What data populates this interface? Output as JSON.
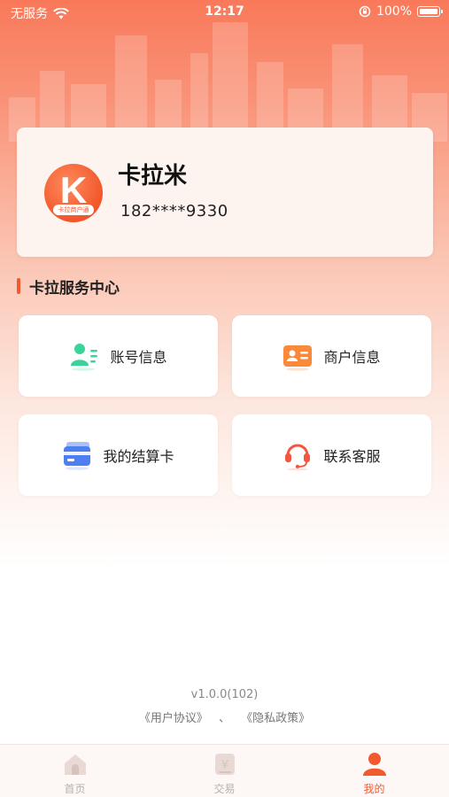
{
  "status_bar": {
    "carrier": "无服务",
    "time": "12:17",
    "battery": "100%"
  },
  "profile": {
    "avatar_letter": "K",
    "avatar_tag": "卡拉商户通",
    "name": "卡拉米",
    "phone": "182****9330"
  },
  "section": {
    "title": "卡拉服务中心"
  },
  "services": [
    {
      "label": "账号信息",
      "icon": "account-icon",
      "color": "#3bd39a"
    },
    {
      "label": "商户信息",
      "icon": "merchant-card-icon",
      "color": "#f98a3c"
    },
    {
      "label": "我的结算卡",
      "icon": "bank-card-icon",
      "color": "#4e7ef0"
    },
    {
      "label": "联系客服",
      "icon": "headset-icon",
      "color": "#f2563f"
    }
  ],
  "footer": {
    "version": "v1.0.0(102)",
    "user_agreement": "《用户协议》",
    "separator": "、",
    "privacy_policy": "《隐私政策》"
  },
  "tabbar": {
    "items": [
      {
        "label": "首页",
        "icon": "home-icon",
        "active": false
      },
      {
        "label": "交易",
        "icon": "transaction-icon",
        "active": false
      },
      {
        "label": "我的",
        "icon": "profile-icon",
        "active": true
      }
    ],
    "active_color": "#f25a2e",
    "inactive_color": "#b9b0ad"
  }
}
